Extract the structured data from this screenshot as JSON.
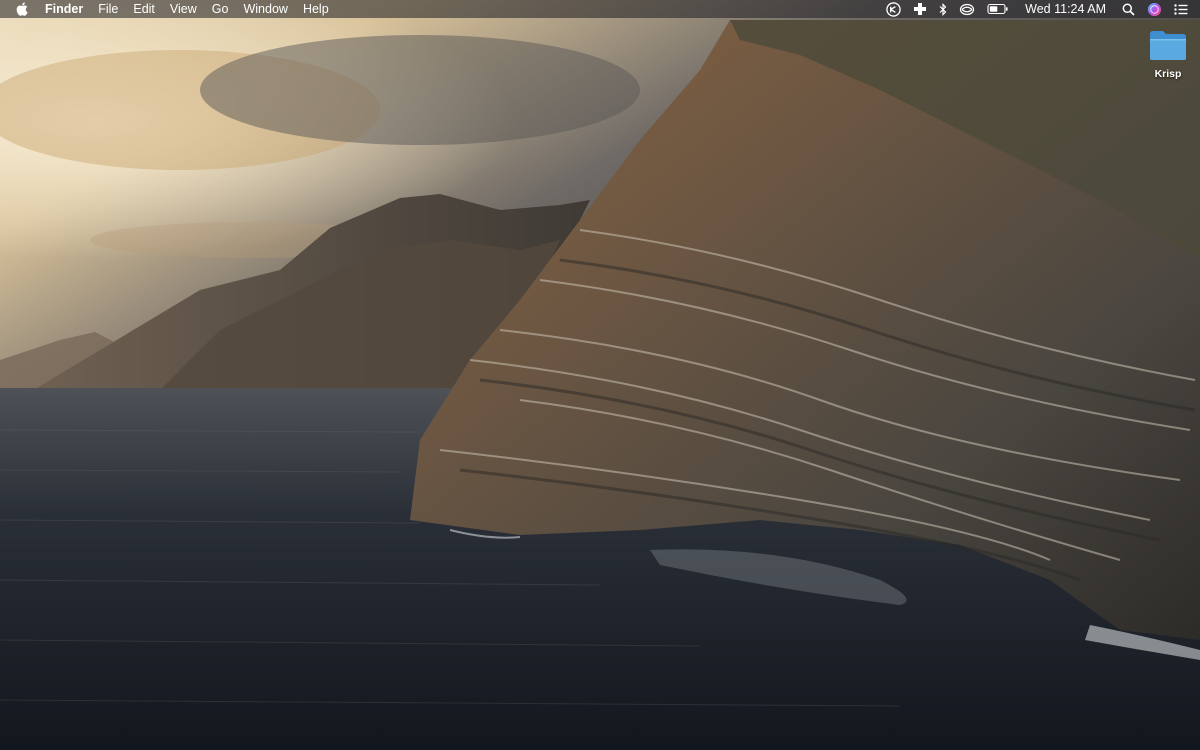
{
  "menubar": {
    "apple_icon": "apple-logo-icon",
    "app_name": "Finder",
    "items": [
      "File",
      "Edit",
      "View",
      "Go",
      "Window",
      "Help"
    ],
    "status_icons": [
      "krisp-icon",
      "medical-cross-icon",
      "bluetooth-icon",
      "wifi-icon",
      "battery-icon"
    ],
    "clock": "Wed 11:24 AM",
    "right_icons": [
      "spotlight-search-icon",
      "siri-icon",
      "notification-center-icon"
    ]
  },
  "desktop": {
    "icons": [
      {
        "label": "Krisp",
        "icon": "folder-icon",
        "color": "#5aa9e0"
      }
    ]
  },
  "wallpaper": {
    "subject": "macOS Catalina coastal cliff wallpaper"
  }
}
